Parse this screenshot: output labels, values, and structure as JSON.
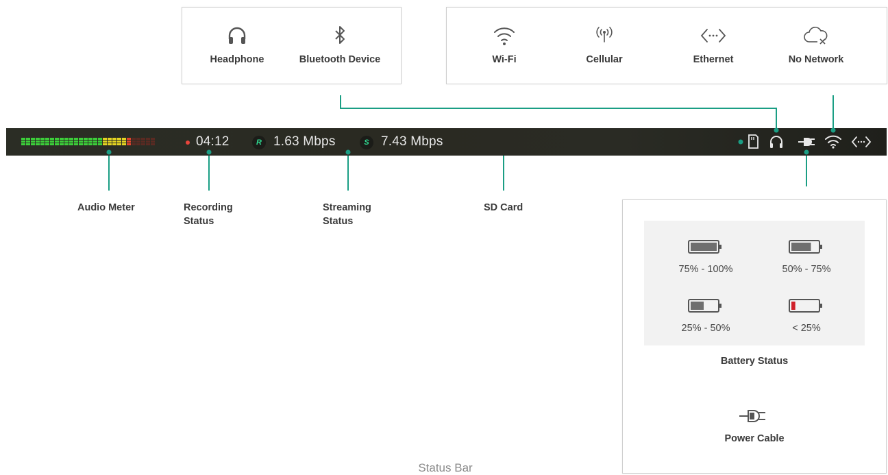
{
  "accent_color": "#1a9e84",
  "audio_panel": {
    "headphone_label": "Headphone",
    "bluetooth_label": "Bluetooth Device"
  },
  "network_panel": {
    "wifi_label": "Wi-Fi",
    "cellular_label": "Cellular",
    "ethernet_label": "Ethernet",
    "no_network_label": "No Network"
  },
  "status_bar": {
    "recording_time": "04:12",
    "recording_badge": "R",
    "recording_rate": "1.63 Mbps",
    "streaming_badge": "S",
    "streaming_rate": "7.43 Mbps",
    "audio_meter_segments": 28,
    "audio_meter_level": 0.82,
    "icons": [
      "sd-card-icon",
      "headphone-icon",
      "power-cable-icon",
      "wifi-icon",
      "ethernet-icon"
    ]
  },
  "callouts": {
    "audio_meter": "Audio Meter",
    "recording_line1": "Recording",
    "recording_line2": "Status",
    "streaming_line1": "Streaming",
    "streaming_line2": "Status",
    "sd_card": "SD Card"
  },
  "battery_panel": {
    "levels": [
      {
        "label": "75% - 100%",
        "fill": 1.0
      },
      {
        "label": "50% - 75%",
        "fill": 0.75
      },
      {
        "label": "25% - 50%",
        "fill": 0.5
      },
      {
        "label": "< 25%",
        "fill": 0.15
      }
    ],
    "title": "Battery Status",
    "power_cable_label": "Power Cable"
  },
  "footer_title": "Status Bar"
}
